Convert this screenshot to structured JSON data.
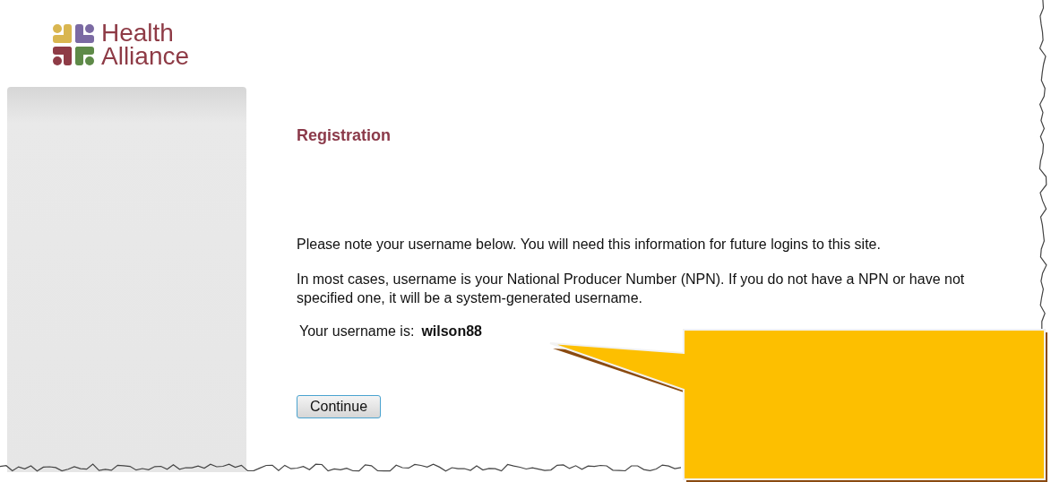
{
  "logo": {
    "lines": [
      "Health",
      "Alliance"
    ]
  },
  "heading": "Registration",
  "paragraphs": [
    "Please note your username below. You will need this information for future logins to this site.",
    "In most cases, username is your National Producer Number (NPN). If you do not have a NPN or have not specified one, it will be a system-generated username."
  ],
  "username": {
    "label": "Your username is:",
    "value": "wilson88"
  },
  "buttons": [
    "Continue"
  ]
}
